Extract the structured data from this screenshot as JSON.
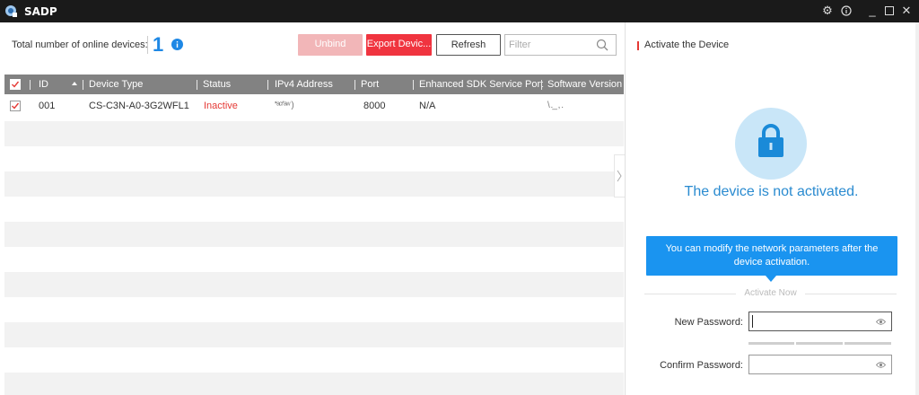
{
  "app": {
    "title": "SADP",
    "icons": [
      "app-logo",
      "gear-icon",
      "info-icon",
      "minimize-icon",
      "maximize-icon",
      "close-icon"
    ]
  },
  "toolbar": {
    "total_label": "Total number of online devices:",
    "total_count": "1",
    "unbind_label": "Unbind",
    "export_label": "Export Devic...",
    "refresh_label": "Refresh",
    "filter_placeholder": "Filter"
  },
  "table": {
    "columns": [
      "ID",
      "Device Type",
      "Status",
      "IPv4 Address",
      "Port",
      "Enhanced SDK Service Port",
      "Software Version"
    ],
    "rows": [
      {
        "id": "001",
        "device_type": "CS-C3N-A0-3G2WFL1",
        "status": "Inactive",
        "ipv4": "'ʻᵃᶜʳʼᵃʷ )",
        "port": "8000",
        "sdk_port": "N/A",
        "version": "\\ ._ ,  .",
        "checked": true
      }
    ]
  },
  "activate": {
    "title": "Activate the Device",
    "status_text": "The device is not activated.",
    "tooltip_line1": "You can modify the network parameters after the",
    "tooltip_line2": "device activation.",
    "section_label": "Activate Now",
    "new_password_label": "New Password:",
    "confirm_password_label": "Confirm Password:",
    "new_password_value": "",
    "confirm_password_value": ""
  },
  "colors": {
    "accent": "#1e88e5",
    "danger": "#f0343f",
    "inactive": "#e53935",
    "header_bg": "#828282",
    "titlebar": "#1a1a1a"
  }
}
